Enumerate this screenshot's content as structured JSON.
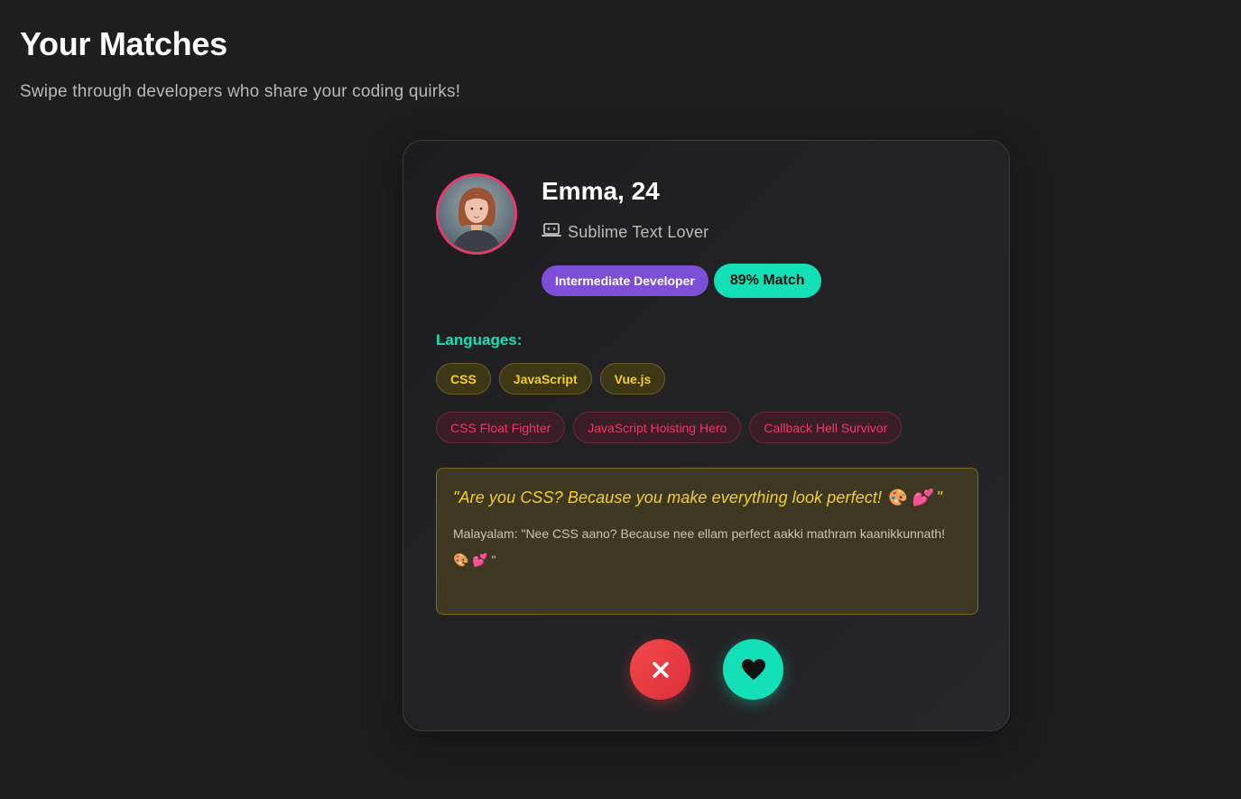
{
  "header": {
    "title": "Your Matches",
    "subtitle": "Swipe through developers who share your coding quirks!"
  },
  "profile": {
    "name_age": "Emma, 24",
    "editor": "Sublime Text Lover",
    "editor_icon": "laptop-code-icon",
    "level": "Intermediate Developer",
    "match": "89% Match",
    "languages_heading": "Languages:",
    "languages": [
      "CSS",
      "JavaScript",
      "Vue.js"
    ],
    "traits": [
      "CSS Float Fighter",
      "JavaScript Hoisting Hero",
      "Callback Hell Survivor"
    ],
    "pickup_line": "\"Are you CSS? Because you make everything look perfect! 🎨 💕 \"",
    "pickup_translation": "Malayalam: \"Nee CSS aano? Because nee ellam perfect aakki mathram kaanikkunnath! 🎨 💕 \""
  },
  "actions": {
    "pass_icon": "close-icon",
    "like_icon": "heart-icon"
  },
  "colors": {
    "accent_teal": "#14e0b8",
    "accent_pink": "#e8396b",
    "accent_purple": "#7d4fd6",
    "accent_yellow": "#f1cf2f",
    "pass_red": "#ef4444"
  }
}
